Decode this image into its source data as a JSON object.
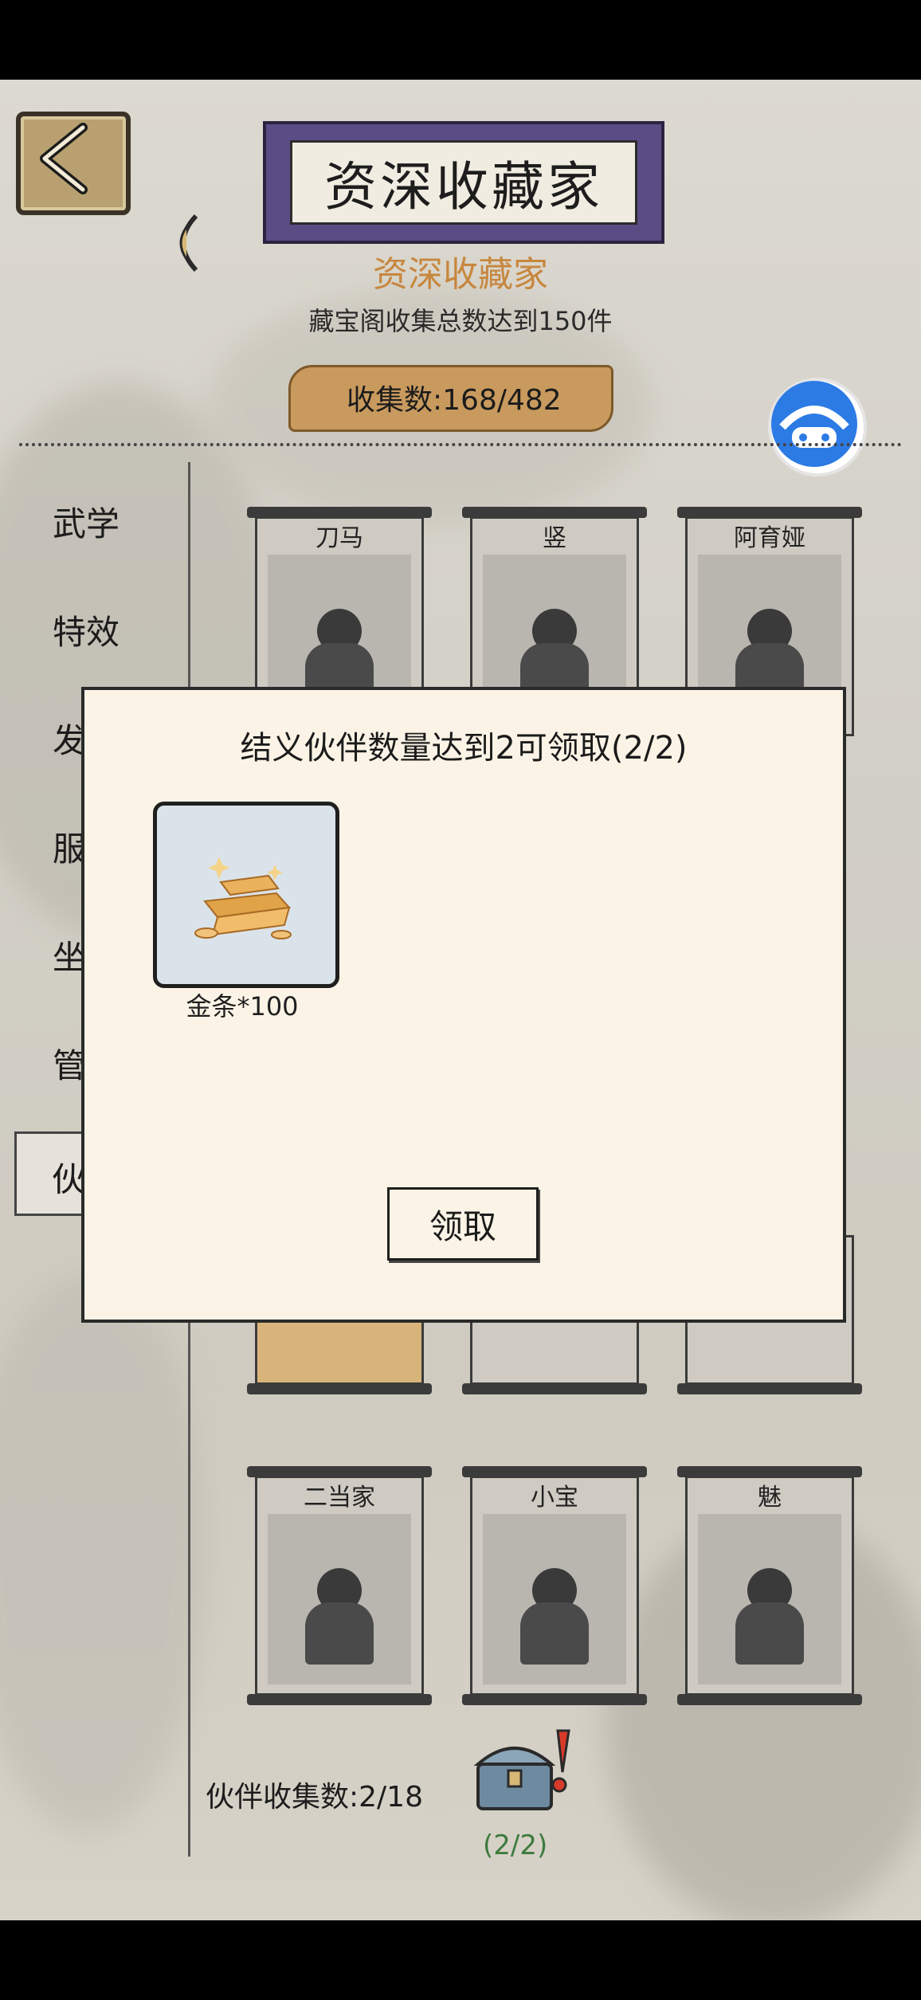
{
  "header": {
    "title_plaque": "资深收藏家",
    "subtitle": "资深收藏家",
    "description": "藏宝阁收集总数达到150件",
    "collect_count": "收集数:168/482"
  },
  "sidebar": {
    "items": [
      {
        "label": "武学"
      },
      {
        "label": "特效"
      },
      {
        "label": "发"
      },
      {
        "label": "服"
      },
      {
        "label": "坐"
      },
      {
        "label": "管"
      },
      {
        "label": "伙"
      }
    ]
  },
  "cards": [
    {
      "name": "刀马"
    },
    {
      "name": "竖"
    },
    {
      "name": "阿育娅"
    },
    {
      "name": "二当家"
    },
    {
      "name": "小宝"
    },
    {
      "name": "魅"
    }
  ],
  "modal": {
    "title": "结义伙伴数量达到2可领取(2/2)",
    "reward_label": "金条*100",
    "claim_label": "领取"
  },
  "footer": {
    "partner_count": "伙伴收集数:2/18",
    "chest_count": "(2/2)"
  },
  "icons": [
    "back-arrow-icon",
    "fan-icon",
    "game-controller-icon",
    "gold-bars-icon",
    "treasure-chest-icon",
    "exclamation-icon"
  ],
  "colors": {
    "accent": "#c7873f",
    "plaque": "#5b4c86",
    "modal_bg": "#fbf4e6",
    "chest_count": "#3d7a3d"
  }
}
